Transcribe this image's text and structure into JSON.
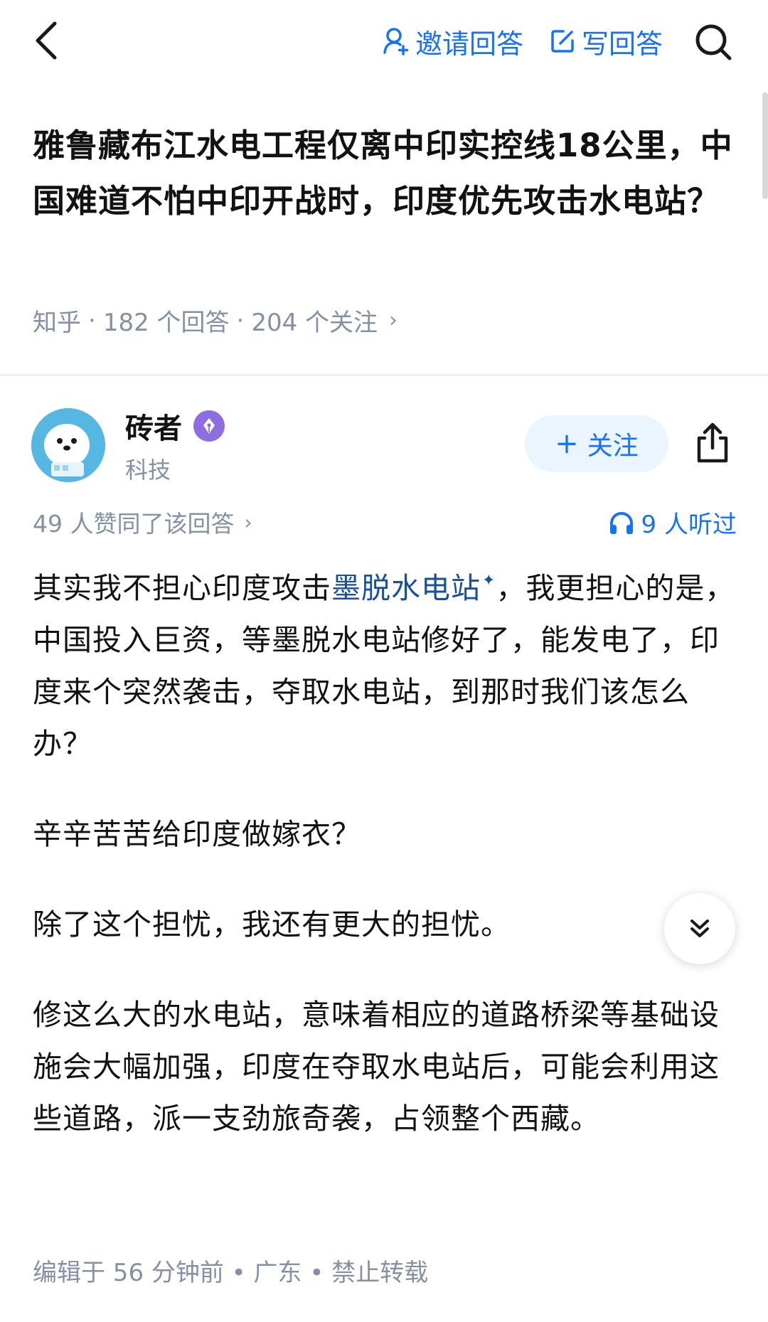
{
  "topbar": {
    "invite_label": "邀请回答",
    "write_label": "写回答"
  },
  "question": {
    "title": "雅鲁藏布江水电工程仅离中印实控线18公里，中国难道不怕中印开战时，印度优先攻击水电站？",
    "source": "知乎",
    "answers_count": "182 个回答",
    "followers_count": "204 个关注",
    "separator": "·"
  },
  "author": {
    "name": "砖者",
    "tag": "科技",
    "follow_label": "关注",
    "follow_plus": "+"
  },
  "stats": {
    "votes_text": "49 人赞同了该回答",
    "listens_text": "9 人听过"
  },
  "answer": {
    "p1_before": "其实我不担心印度攻击",
    "p1_keyword": "墨脱水电站",
    "p1_keyword_mark": "✦",
    "p1_after": "，我更担心的是，中国投入巨资，等墨脱水电站修好了，能发电了，印度来个突然袭击，夺取水电站，到那时我们该怎么办？",
    "p2": "辛辛苦苦给印度做嫁衣？",
    "p3": "除了这个担忧，我还有更大的担忧。",
    "p4": "修这么大的水电站，意味着相应的道路桥梁等基础设施会大幅加强，印度在夺取水电站后，可能会利用这些道路，派一支劲旅奇袭，占领整个西藏。"
  },
  "footer": {
    "meta": "编辑于 56 分钟前 • 广东 • 禁止转载"
  },
  "colors": {
    "accent": "#1772f6",
    "keyword": "#175199",
    "meta_gray": "#8590a6",
    "follow_bg": "#ebf5ff",
    "badge": "#8d6ee0"
  },
  "icons": {
    "back": "chevron-left-icon",
    "invite": "person-plus-icon",
    "write": "edit-icon",
    "search": "search-icon",
    "share": "share-icon",
    "listen": "headphones-icon",
    "expand": "double-chevron-down-icon",
    "badge": "pen-nib-icon"
  }
}
